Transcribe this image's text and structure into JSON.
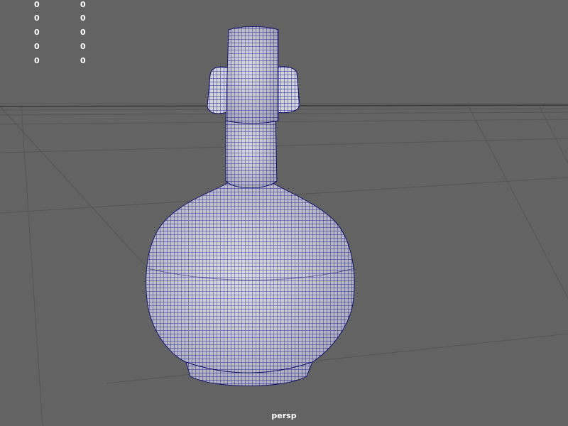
{
  "hud": {
    "rows": [
      {
        "a": "0",
        "b": "0"
      },
      {
        "a": "0",
        "b": "0"
      },
      {
        "a": "0",
        "b": "0"
      },
      {
        "a": "0",
        "b": "0"
      },
      {
        "a": "0",
        "b": "0"
      }
    ]
  },
  "viewport": {
    "camera_label": "persp",
    "display_mode": "wireframe-on-shaded",
    "object": "vase mesh",
    "colors": {
      "background": "#636363",
      "grid": "#505050",
      "grid_axis": "#3a3a3a",
      "mesh_fill": "#d6d6dc",
      "wire": "#1a1a8a"
    }
  }
}
